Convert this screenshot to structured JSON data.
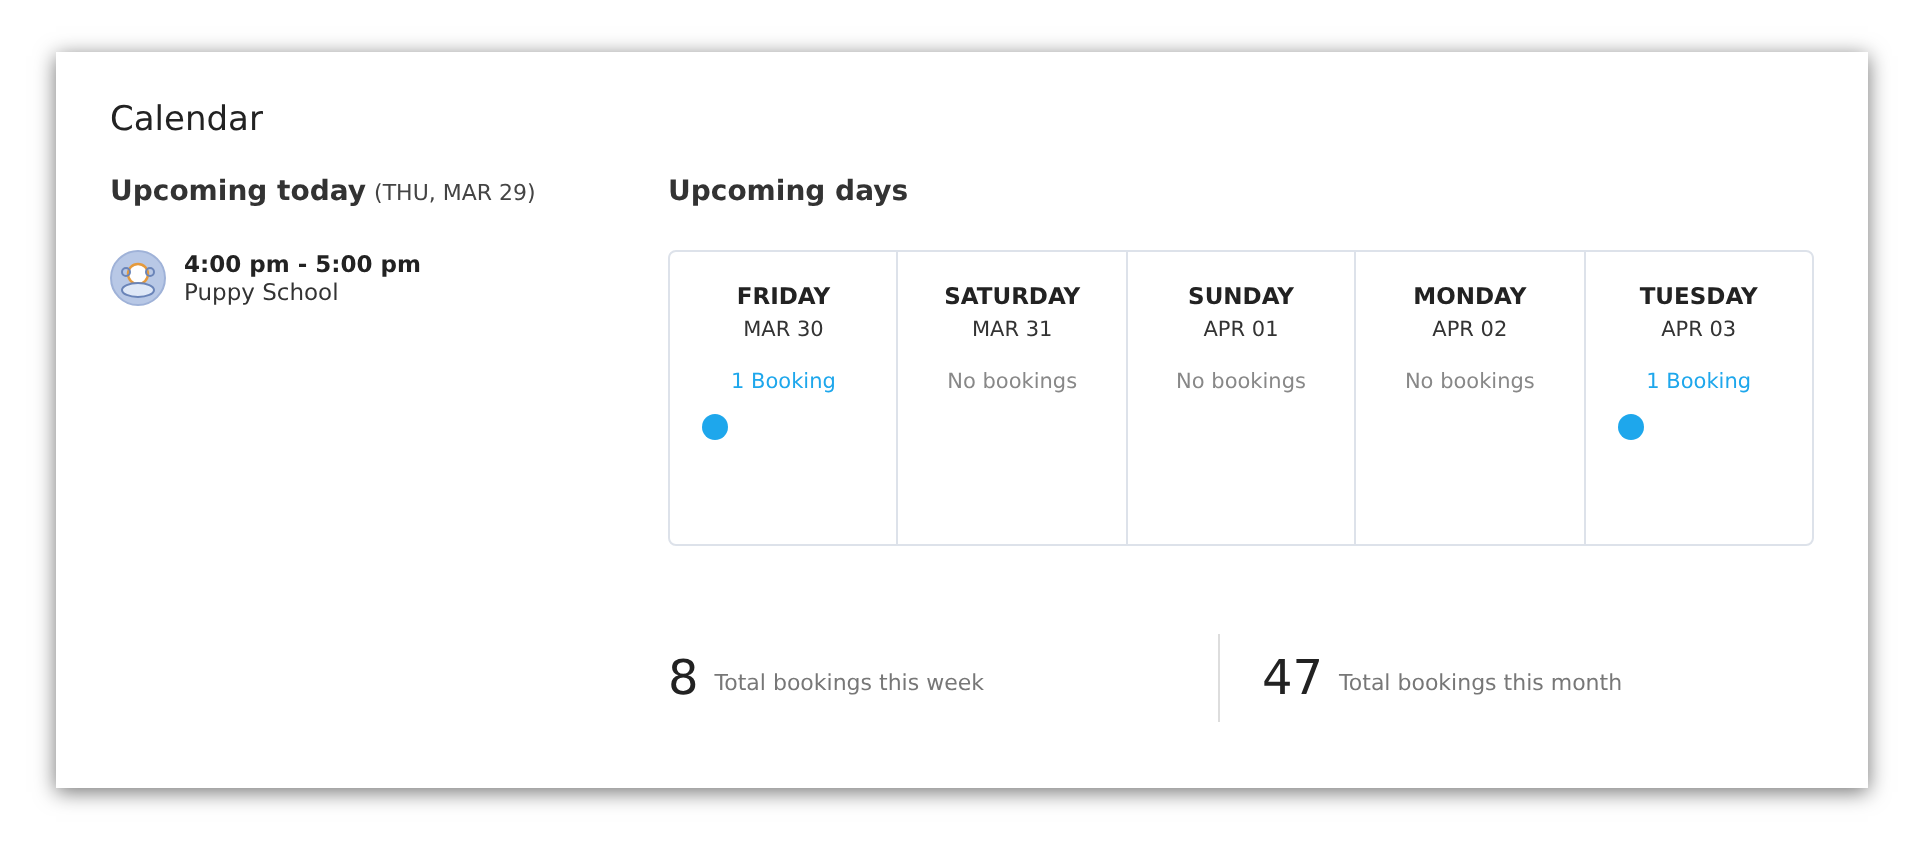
{
  "title": "Calendar",
  "today": {
    "heading": "Upcoming today",
    "date": "(THU, MAR 29)",
    "events": [
      {
        "time": "4:00 pm - 5:00 pm",
        "name": "Puppy School"
      }
    ]
  },
  "upcoming": {
    "heading": "Upcoming days",
    "days": [
      {
        "weekday": "FRIDAY",
        "date": "MAR 30",
        "bookings": "1 Booking",
        "kind": "booked",
        "color": "#1ea7ec"
      },
      {
        "weekday": "SATURDAY",
        "date": "MAR 31",
        "bookings": "No bookings",
        "kind": "empty"
      },
      {
        "weekday": "SUNDAY",
        "date": "APR 01",
        "bookings": "No bookings",
        "kind": "empty"
      },
      {
        "weekday": "MONDAY",
        "date": "APR 02",
        "bookings": "No bookings",
        "kind": "empty"
      },
      {
        "weekday": "TUESDAY",
        "date": "APR 03",
        "bookings": "1 Booking",
        "kind": "booked",
        "color": "#1ea7ec"
      }
    ]
  },
  "totals": [
    {
      "value": "8",
      "label": "Total bookings this week"
    },
    {
      "value": "47",
      "label": "Total bookings this month"
    }
  ]
}
